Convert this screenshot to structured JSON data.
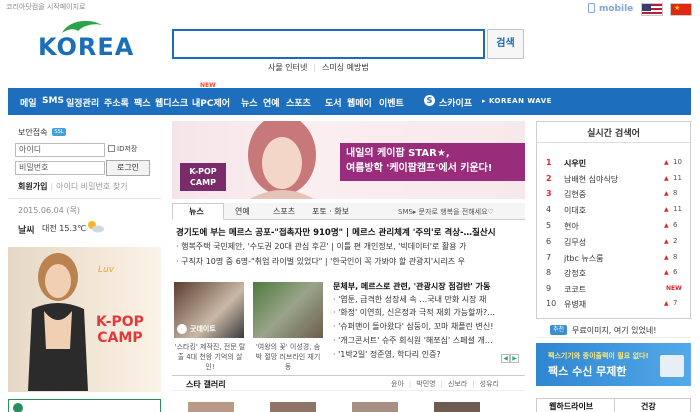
{
  "header": {
    "top_note": "코리아닷컴을 시작페이지로",
    "logo_text": "KOREA",
    "mobile_label": "mobile",
    "search_button": "검색",
    "sub_links": [
      "사물 인터넷",
      "스미싱 예방법"
    ]
  },
  "gnb": {
    "items": [
      "메일",
      "SMS",
      "일정관리",
      "주소록",
      "팩스",
      "웹디스크",
      "내PC제어",
      "뉴스",
      "연예",
      "스포츠",
      "도서",
      "웹메이",
      "이벤트",
      "스카이프"
    ],
    "new_badge": "NEW",
    "korean_wave": "▸ KOREAN WAVE"
  },
  "login": {
    "title": "보안접속",
    "ssl_badge": "SSL",
    "id_placeholder": "아이디",
    "pw_placeholder": "비밀번호",
    "id_save": "ID저장",
    "login_button": "로그인",
    "join": "회원가입",
    "find": "아이디 비밀번호 찾기"
  },
  "weather": {
    "date": "2015.06.04 (목)",
    "label": "날씨",
    "city_temp": "대전 15.3℃"
  },
  "left_ad": {
    "deco": "Luv",
    "text_line1": "K-POP",
    "text_line2": "CAMP"
  },
  "main_banner": {
    "badge_line1": "K-POP",
    "badge_line2": "CAMP",
    "line1": "내일의 케이팝 STAR★,",
    "line2": "여름방학 '케이팝캠프'에서 키운다!"
  },
  "news_tabs": {
    "tabs": [
      "뉴스",
      "연예",
      "스포츠",
      "포토 · 화보"
    ],
    "sms_note": "SMS▸ 문자로 행복을 전해세요♡"
  },
  "headlines": [
    "경기도에 부는 메르스 공포-\"접촉자만 910명\"  |  메르스 관리체계 '주의'로 격상-…질산시",
    "· 행복주택 국민제안, '수도권 20대 관심 후끈'  |  이틀 편 개인정보, '빅데이터'로 활용 가",
    "· 구직자 10명 중 6명-\"취업 라이벌 있었다\"  |  '한국인이 꼭 가봐야 할 관광지'시리즈 우"
  ],
  "thumbs": [
    {
      "caption_overlay": "굿데이트",
      "caption": "'스타킹' 제작진, 전문 탈출 4대 천왕 기억의 살인!"
    },
    {
      "caption": "'여왕의 꽃' 이성경, 숨 박 절망 러브라인 재기 동"
    }
  ],
  "sub_news": [
    "문체부, 메르스로 관련, '관광시장 점검반' 가동",
    "· '엽툰, 급격한 성장세 속 …국내 만화 시장 재",
    "· '화정' 이연희, 신은정과 극적 재회 가능할까?…",
    "· '슈퍼맨이 돌아왔다' 삼둥이, 꼬마 채플린 변신!",
    "· '개그콘서트' 슈주 회식원 '해쪼심' 스페셜 개…",
    "· '1박2일' 정준영, 학다리 인증?"
  ],
  "gallery": {
    "title": "스타 갤러리",
    "names": [
      "윤아",
      "박민영",
      "신보라",
      "성유리"
    ]
  },
  "realtime": {
    "title": "실시간 검색어",
    "items": [
      {
        "rank": "1",
        "term": "시우민",
        "val": "10",
        "status": "up"
      },
      {
        "rank": "2",
        "term": "남배현 심야식당",
        "val": "11",
        "status": "up"
      },
      {
        "rank": "3",
        "term": "김현중",
        "val": "8",
        "status": "up"
      },
      {
        "rank": "4",
        "term": "이대호",
        "val": "11",
        "status": "up"
      },
      {
        "rank": "5",
        "term": "현아",
        "val": "6",
        "status": "up"
      },
      {
        "rank": "6",
        "term": "김무성",
        "val": "2",
        "status": "up"
      },
      {
        "rank": "7",
        "term": "jtbc 뉴스룸",
        "val": "8",
        "status": "up"
      },
      {
        "rank": "8",
        "term": "강정호",
        "val": "6",
        "status": "up"
      },
      {
        "rank": "9",
        "term": "코코트",
        "val": "NEW",
        "status": "new"
      },
      {
        "rank": "10",
        "term": "유병재",
        "val": "7",
        "status": "up"
      }
    ]
  },
  "notice": {
    "badge": "추천",
    "text": "무료이미지, 여기 있었네!"
  },
  "fax_ad": {
    "line1": "팩스기기와 종이출력이 필요 없다!",
    "line2": "팩스 수신 무제한"
  },
  "bottom_tabs": [
    "웹하드라이브",
    "건강"
  ],
  "colors": {
    "brand_blue": "#1d6fbd",
    "rank_red": "#e2242a"
  }
}
